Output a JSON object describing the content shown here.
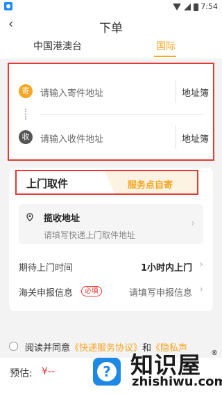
{
  "status_bar": {
    "time": "7:54"
  },
  "header": {
    "back_icon": "‹",
    "title": "下单"
  },
  "tabs": [
    {
      "label": "中国港澳台",
      "active": false
    },
    {
      "label": "国际",
      "active": true
    }
  ],
  "address": {
    "sender": {
      "badge": "寄",
      "placeholder": "请输入寄件地址",
      "book_label": "地址簿"
    },
    "receiver": {
      "badge": "收",
      "placeholder": "请输入收件地址",
      "book_label": "地址簿"
    }
  },
  "pickup_mode": {
    "active_label": "上门取件",
    "inactive_label": "服务点自寄"
  },
  "pickup": {
    "title": "揽收地址",
    "hint": "请填写快递上门取件地址",
    "expected_time_label": "期待上门时间",
    "expected_time_value": "1小时内上门",
    "customs_label": "海关申报信息",
    "customs_tag": "必填",
    "customs_placeholder": "请填写申报信息"
  },
  "agreement": {
    "prefix": "阅读并同意",
    "link1": "《快递服务协议》",
    "and": "和",
    "link2": "《隐私声"
  },
  "bottom": {
    "estimate_label": "预估:",
    "estimate_value": "¥--",
    "help_icon": "?"
  },
  "watermark": {
    "cn": "知识屋",
    "reg": "®",
    "en": "zhishiwu.com"
  },
  "colors": {
    "accent": "#f5a623",
    "highlight": "#e53935",
    "help": "#1e88e5"
  }
}
